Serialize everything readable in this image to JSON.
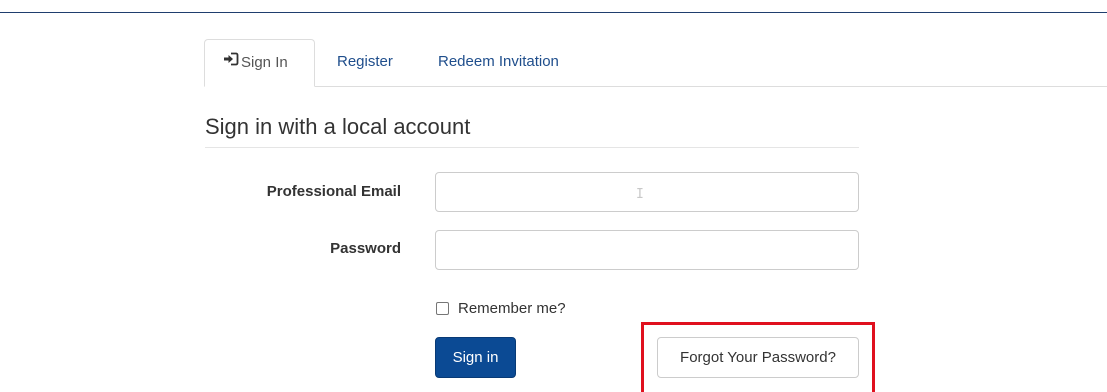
{
  "tabs": {
    "sign_in": "Sign In",
    "register": "Register",
    "redeem_invitation": "Redeem Invitation"
  },
  "form": {
    "heading": "Sign in with a local account",
    "email_label": "Professional Email",
    "email_value": "",
    "password_label": "Password",
    "password_value": "",
    "remember_label": "Remember me?",
    "remember_checked": false,
    "sign_in_button": "Sign in",
    "forgot_button": "Forgot Your Password?"
  },
  "icons": {
    "sign_in_tab": "sign-in-icon",
    "remember": "checkbox"
  },
  "colors": {
    "primary": "#0b4a94",
    "link": "#1f4e8c",
    "highlight": "#e0101e",
    "top_rule": "#1f3e6e"
  }
}
